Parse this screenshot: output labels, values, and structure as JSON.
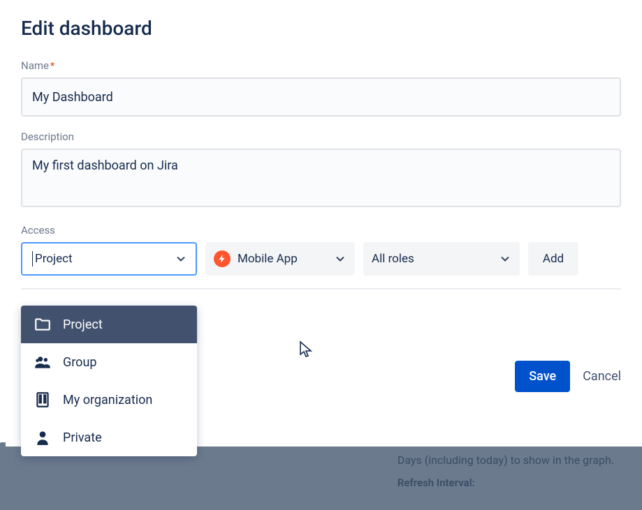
{
  "title": "Edit dashboard",
  "fields": {
    "name": {
      "label": "Name",
      "required": true,
      "value": "My Dashboard"
    },
    "description": {
      "label": "Description",
      "value": "My first dashboard on Jira"
    },
    "access": {
      "label": "Access",
      "primary_select": {
        "value": "Project"
      },
      "scope_select": {
        "value": "Mobile App"
      },
      "role_select": {
        "placeholder": "All roles"
      },
      "add_button": "Add"
    }
  },
  "dropdown_options": [
    {
      "label": "Project",
      "icon": "folder"
    },
    {
      "label": "Group",
      "icon": "group"
    },
    {
      "label": "My organization",
      "icon": "building"
    },
    {
      "label": "Private",
      "icon": "person"
    }
  ],
  "footer": {
    "save": "Save",
    "cancel": "Cancel"
  },
  "backdrop": {
    "days_text": "Days (including today) to show in the graph.",
    "refresh_label": "Refresh Interval:"
  }
}
